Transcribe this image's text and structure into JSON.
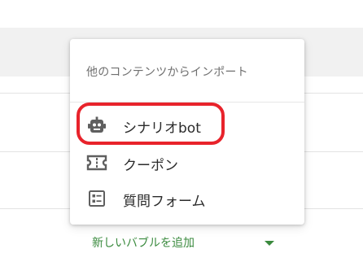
{
  "menu": {
    "header": "他のコンテンツからインポート",
    "items": [
      {
        "label": "シナリオbot",
        "icon": "robot-icon"
      },
      {
        "label": "クーポン",
        "icon": "ticket-icon"
      },
      {
        "label": "質問フォーム",
        "icon": "form-icon"
      }
    ],
    "highlighted_item": "シナリオbot",
    "highlight_color": "#e8232b"
  },
  "add_bubble": {
    "label": "新しいバブルを追加",
    "arrow": "caret-down-icon",
    "color": "#3a8a3e"
  }
}
